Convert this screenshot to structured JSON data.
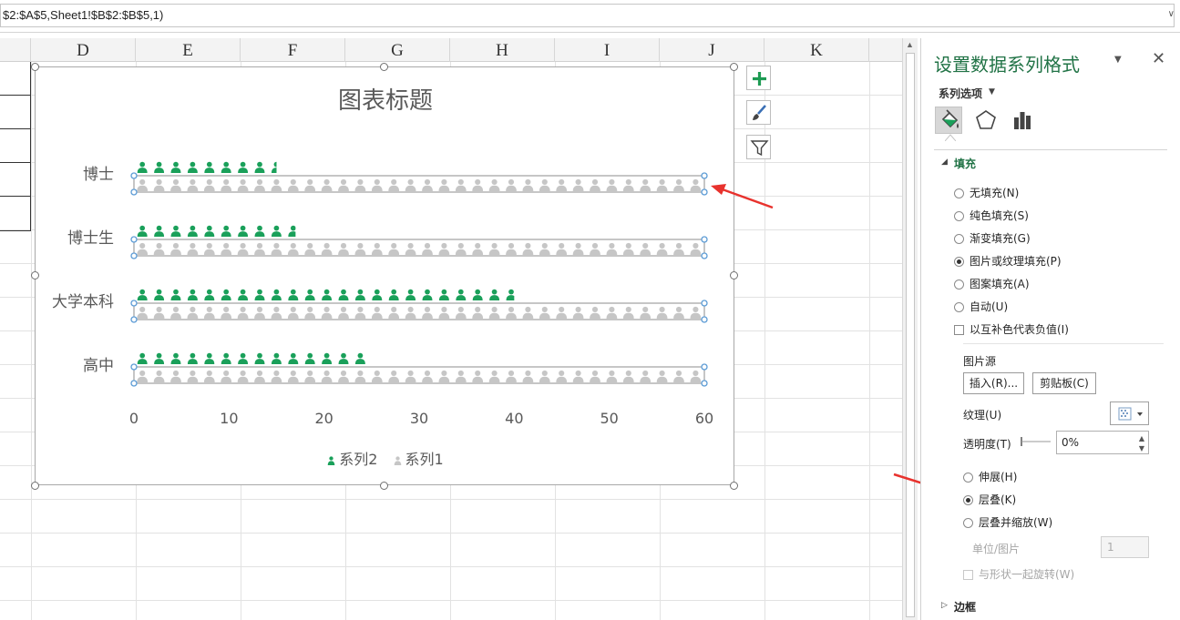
{
  "formula_bar": {
    "text": "$2:$A$5,Sheet1!$B$2:$B$5,1)"
  },
  "columns": [
    "D",
    "E",
    "F",
    "G",
    "H",
    "I",
    "J",
    "K"
  ],
  "chart": {
    "title": "图表标题",
    "categories": [
      "博士",
      "博士生",
      "大学本科",
      "高中"
    ],
    "x_ticks": [
      "0",
      "10",
      "20",
      "30",
      "40",
      "50",
      "60"
    ],
    "legend": [
      "系列2",
      "系列1"
    ],
    "colors": {
      "series2": "#1aa05a",
      "series1": "#c6c6c6",
      "selection": "#5b9bd5"
    }
  },
  "chart_data": {
    "type": "bar",
    "title": "图表标题",
    "categories": [
      "博士",
      "博士生",
      "大学本科",
      "高中"
    ],
    "series": [
      {
        "name": "系列2",
        "values": [
          15,
          17,
          40,
          25
        ]
      },
      {
        "name": "系列1",
        "values": [
          60,
          60,
          60,
          60
        ]
      }
    ],
    "xlim": [
      0,
      60
    ],
    "xticks": [
      0,
      10,
      20,
      30,
      40,
      50,
      60
    ],
    "orientation": "horizontal",
    "legend_position": "bottom",
    "grid": false
  },
  "pane": {
    "title": "设置数据系列格式",
    "series_options": "系列选项",
    "fill_section": "填充",
    "fill_options": [
      {
        "label": "无填充(N)",
        "selected": false
      },
      {
        "label": "纯色填充(S)",
        "selected": false
      },
      {
        "label": "渐变填充(G)",
        "selected": false
      },
      {
        "label": "图片或纹理填充(P)",
        "selected": true
      },
      {
        "label": "图案填充(A)",
        "selected": false
      },
      {
        "label": "自动(U)",
        "selected": false
      }
    ],
    "invert_negative": "以互补色代表负值(I)",
    "picture_source": "图片源",
    "insert_button": "插入(R)...",
    "clipboard_button": "剪贴板(C)",
    "texture_label": "纹理(U)",
    "transparency_label": "透明度(T)",
    "transparency_value": "0%",
    "stack_options": [
      {
        "label": "伸展(H)",
        "selected": false
      },
      {
        "label": "层叠(K)",
        "selected": true
      },
      {
        "label": "层叠并缩放(W)",
        "selected": false
      }
    ],
    "unit_label": "单位/图片",
    "unit_value": "1",
    "rotate_with_shape": "与形状一起旋转(W)",
    "border_section": "边框"
  }
}
